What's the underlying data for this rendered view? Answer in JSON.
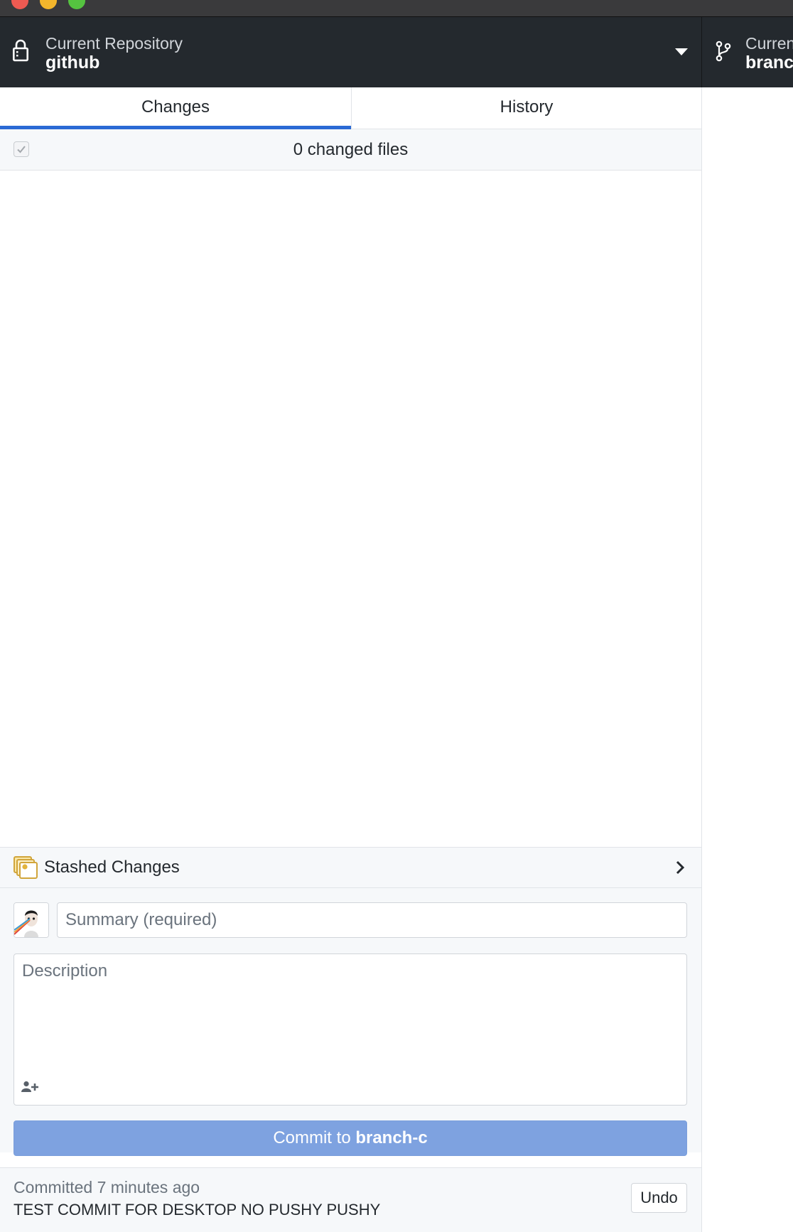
{
  "window": {
    "controls": [
      "close",
      "minimize",
      "maximize"
    ]
  },
  "toolbar": {
    "repository": {
      "label": "Current Repository",
      "value": "github",
      "icon": "lock-icon",
      "dropdown_icon": "triangle-down-icon"
    },
    "branch": {
      "label": "Current Branch",
      "value": "branch-c",
      "icon": "git-branch-icon"
    }
  },
  "tabs": [
    {
      "label": "Changes",
      "selected": true
    },
    {
      "label": "History",
      "selected": false
    }
  ],
  "changes": {
    "count_text": "0 changed files",
    "select_all_checked": true
  },
  "stash": {
    "label": "Stashed Changes",
    "icon": "stash-icon",
    "expand_icon": "chevron-right-icon"
  },
  "commit": {
    "summary_placeholder": "Summary (required)",
    "summary_value": "",
    "description_placeholder": "Description",
    "description_value": "",
    "coauthor_icon": "person-add-icon",
    "button_prefix": "Commit to ",
    "button_branch": "branch-c"
  },
  "last_commit": {
    "meta": "Committed 7 minutes ago",
    "message": "TEST COMMIT FOR DESKTOP NO PUSHY PUSHY",
    "undo_label": "Undo"
  },
  "colors": {
    "toolbar_bg": "#24292e",
    "accent": "#2a6ad5",
    "commit_button_bg": "#7ea2e0",
    "panel_bg": "#f6f8fa"
  }
}
